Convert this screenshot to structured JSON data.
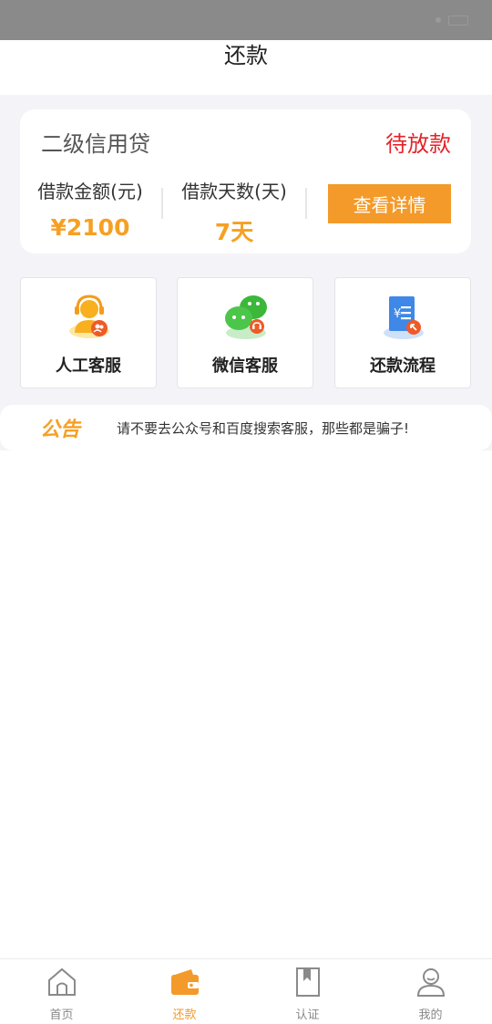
{
  "header": {
    "title": "还款"
  },
  "loan": {
    "name": "二级信用贷",
    "status": "待放款",
    "amount_label": "借款金额(元)",
    "amount_value": "¥2100",
    "days_label": "借款天数(天)",
    "days_value": "7天",
    "details_button": "查看详情"
  },
  "services": [
    {
      "label": "人工客服",
      "icon": "customer-service-icon"
    },
    {
      "label": "微信客服",
      "icon": "wechat-icon"
    },
    {
      "label": "还款流程",
      "icon": "repayment-process-icon"
    }
  ],
  "notice": {
    "tag": "公告",
    "text": "请不要去公众号和百度搜索客服，那些都是骗子!"
  },
  "tabs": [
    {
      "label": "首页",
      "icon": "home-icon",
      "active": false
    },
    {
      "label": "还款",
      "icon": "wallet-icon",
      "active": true
    },
    {
      "label": "认证",
      "icon": "bookmark-icon",
      "active": false
    },
    {
      "label": "我的",
      "icon": "user-icon",
      "active": false
    }
  ],
  "colors": {
    "accent": "#f39a2a",
    "amount": "#f6a023",
    "status_red": "#e3232a",
    "wechat_green": "#3bb83a",
    "doc_blue": "#3f88e8"
  }
}
